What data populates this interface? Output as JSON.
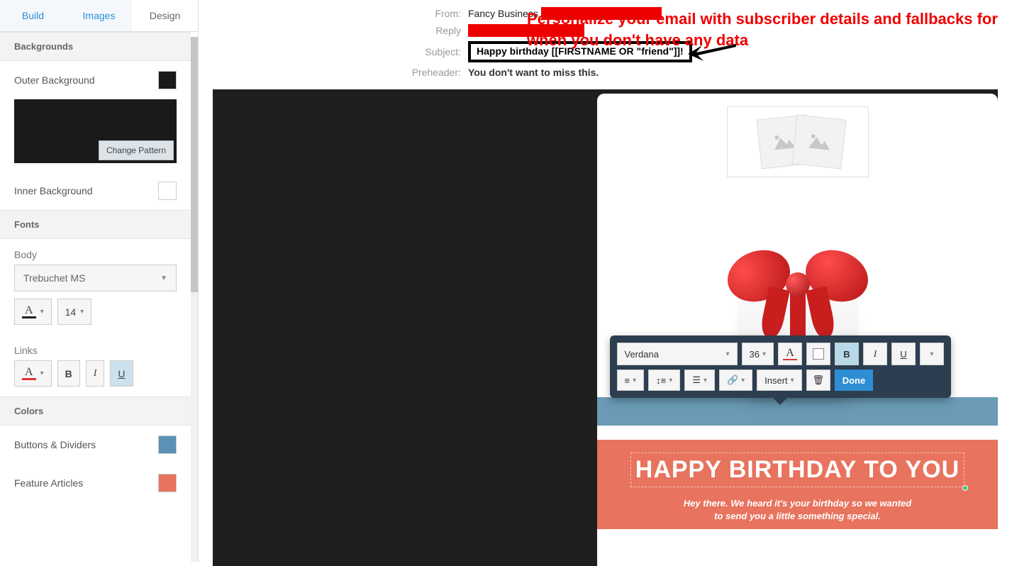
{
  "tabs": {
    "build": "Build",
    "images": "Images",
    "design": "Design",
    "active": "design"
  },
  "sidebar": {
    "backgrounds_header": "Backgrounds",
    "outer_bg_label": "Outer Background",
    "change_pattern": "Change Pattern",
    "inner_bg_label": "Inner Background",
    "fonts_header": "Fonts",
    "body_label": "Body",
    "body_font": "Trebuchet MS",
    "body_size": "14",
    "links_label": "Links",
    "bold": "B",
    "italic": "I",
    "underline": "U",
    "colors_header": "Colors",
    "buttons_dividers": "Buttons & Dividers",
    "feature_articles": "Feature Articles",
    "colors": {
      "outer": "#1a1a1a",
      "inner": "#ffffff",
      "buttons": "#5a91b5",
      "feature": "#e8735e"
    }
  },
  "header": {
    "from_label": "From:",
    "from_value": "Fancy Business",
    "reply_label": "Reply",
    "subject_label": "Subject:",
    "subject_value": "Happy birthday [[FIRSTNAME OR \"friend\"]]!",
    "preheader_label": "Preheader:",
    "preheader_value": "You don't want to miss this."
  },
  "annotation": "Personalize your email with subscriber details and fallbacks for when you don't have any data",
  "preview": {
    "headline": "HAPPY BIRTHDAY TO YOU",
    "sub1": "Hey there. We heard it's your birthday so we wanted",
    "sub2": "to send you a little something special."
  },
  "toolbar": {
    "font": "Verdana",
    "size": "36",
    "bold": "B",
    "italic": "I",
    "underline": "U",
    "insert": "Insert",
    "done": "Done"
  }
}
